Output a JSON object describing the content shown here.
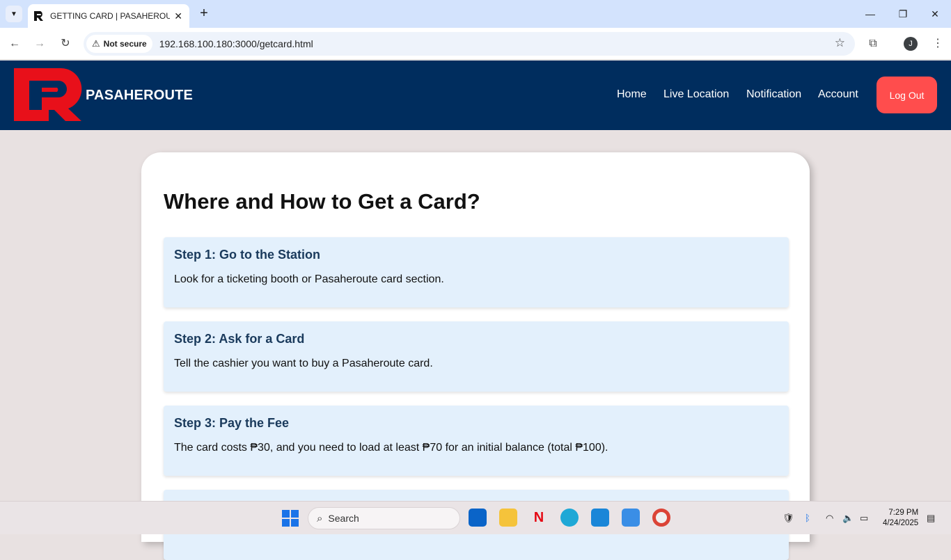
{
  "browser": {
    "tab_title": "GETTING CARD | PASAHEROUTE",
    "security_label": "Not secure",
    "url": "192.168.100.180:3000/getcard.html",
    "profile_initial": "J"
  },
  "site": {
    "brand": "PASAHEROUTE",
    "nav": [
      "Home",
      "Live Location",
      "Notification",
      "Account"
    ],
    "logout_label": "Log Out",
    "colors": {
      "header": "#002d5e",
      "logo": "#e8101a",
      "logout": "#ff4d4d",
      "step_bg": "#e3f0fc"
    }
  },
  "main": {
    "title": "Where and How to Get a Card?",
    "steps": [
      {
        "title": "Step 1: Go to the Station",
        "text": "Look for a ticketing booth or Pasaheroute card section."
      },
      {
        "title": "Step 2: Ask for a Card",
        "text": "Tell the cashier you want to buy a Pasaheroute card."
      },
      {
        "title": "Step 3: Pay the Fee",
        "text": "The card costs ₱30, and you need to load at least ₱70 for an initial balance (total ₱100)."
      }
    ]
  },
  "taskbar": {
    "search_placeholder": "Search",
    "time": "7:29 PM",
    "date": "4/24/2025",
    "apps": [
      "outlook-icon",
      "file-explorer-icon",
      "netflix-icon",
      "edge-icon",
      "vscode-icon",
      "photos-icon",
      "chrome-icon"
    ]
  }
}
